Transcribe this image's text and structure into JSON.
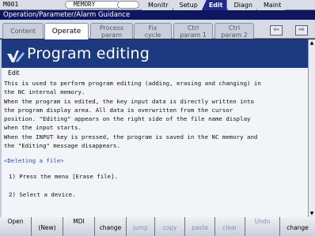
{
  "status": {
    "alarm": "M001",
    "memory_label": "MEMORY",
    "top_tabs": [
      "Monitr",
      "Setup",
      "Edit",
      "Diagn",
      "Maint"
    ],
    "active_top_tab": "Edit"
  },
  "window_title": "Operation/Parameter/Alarm Guidance",
  "subtabs": [
    {
      "l1": "Content",
      "l2": ""
    },
    {
      "l1": "Operate",
      "l2": ""
    },
    {
      "l1": "Process",
      "l2": "param"
    },
    {
      "l1": "Fix",
      "l2": "cycle"
    },
    {
      "l1": "Ctrl",
      "l2": "param 1"
    },
    {
      "l1": "Ctrl",
      "l2": "param 2"
    }
  ],
  "nav": {
    "prev_icon": "arrow-left-icon",
    "next_icon": "arrow-right-icon"
  },
  "content": {
    "title": "Program editing",
    "icon_label": "Edit",
    "paragraphs": [
      "This is used to perform program editing (adding, erasing and changing) in",
      "the NC internal memory.",
      "When the program is edited, the key input data is directly written into",
      "the program display area. All data is overwritten from the cursor",
      "position. \"Editing\" appears on the right side of the file name display",
      "when the input starts.",
      "When the INPUT key is pressed, the program is saved in the NC memory and",
      "the \"Editing\" message disappears."
    ],
    "section_link": "<Deleting a file>",
    "step1": "1) Press the menu [Erase file].",
    "step2": "2) Select a device."
  },
  "menu": [
    {
      "l1": "Open",
      "l2": "",
      "enabled": true
    },
    {
      "l1": "",
      "l2": "(New)",
      "enabled": true
    },
    {
      "l1": "MDI",
      "l2": "",
      "enabled": true
    },
    {
      "l1": "",
      "l2": "change",
      "enabled": true
    },
    {
      "l1": "",
      "l2": "jump",
      "enabled": false
    },
    {
      "l1": "",
      "l2": "copy",
      "enabled": false
    },
    {
      "l1": "",
      "l2": "paste",
      "enabled": false
    },
    {
      "l1": "",
      "l2": "clear",
      "enabled": false
    },
    {
      "l1": "Undo",
      "l2": "",
      "enabled": false
    },
    {
      "l1": "",
      "l2": "change",
      "enabled": true
    }
  ],
  "colors": {
    "accent": "#1f2a8a",
    "title_bar": "#0e1660",
    "heading": "#1d3a80",
    "link": "#2a4bb8"
  }
}
